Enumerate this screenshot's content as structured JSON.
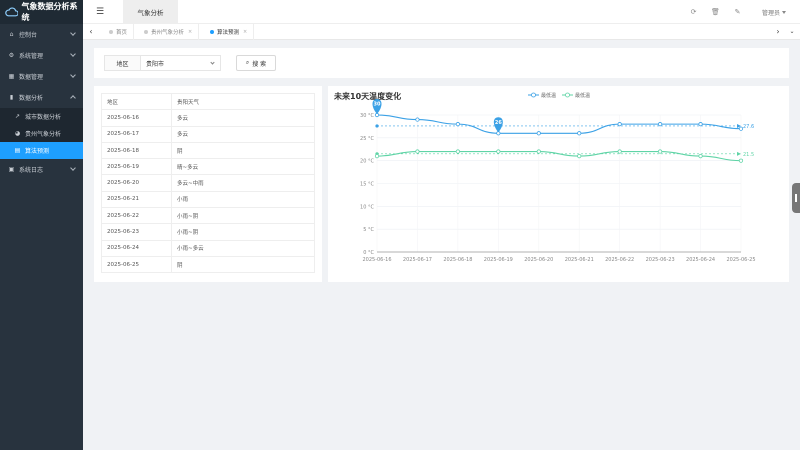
{
  "app": {
    "title": "气象数据分析系统"
  },
  "sidebar": {
    "items": [
      {
        "label": "控制台",
        "icon": "home-icon"
      },
      {
        "label": "系统管理",
        "icon": "gears-icon"
      },
      {
        "label": "数据管理",
        "icon": "grid-icon"
      },
      {
        "label": "数据分析",
        "icon": "chart-icon",
        "expanded": true,
        "children": [
          {
            "label": "城市数据分析",
            "icon": "line-chart-icon"
          },
          {
            "label": "贵州气象分析",
            "icon": "pie-chart-icon"
          },
          {
            "label": "算法预测",
            "icon": "document-icon",
            "active": true
          }
        ]
      },
      {
        "label": "系统日志",
        "icon": "log-icon"
      }
    ]
  },
  "header": {
    "tab": "气象分析",
    "user": "管理员"
  },
  "tabs": [
    {
      "label": "首页",
      "closable": false
    },
    {
      "label": "贵州气象分析",
      "closable": true
    },
    {
      "label": "算法预测",
      "closable": true,
      "active": true
    }
  ],
  "search": {
    "label": "地区",
    "value": "贵阳市",
    "button": "搜 索"
  },
  "table": {
    "headers": [
      "地区",
      "贵阳天气"
    ],
    "rows": [
      [
        "2025-06-16",
        "多云"
      ],
      [
        "2025-06-17",
        "多云"
      ],
      [
        "2025-06-18",
        "阴"
      ],
      [
        "2025-06-19",
        "晴~多云"
      ],
      [
        "2025-06-20",
        "多云~中雨"
      ],
      [
        "2025-06-21",
        "小雨"
      ],
      [
        "2025-06-22",
        "小雨~阴"
      ],
      [
        "2025-06-23",
        "小雨~阴"
      ],
      [
        "2025-06-24",
        "小雨~多云"
      ],
      [
        "2025-06-25",
        "阴"
      ]
    ]
  },
  "chart_data": {
    "type": "line",
    "title": "未来10天温度变化",
    "x": [
      "2025-06-16",
      "2025-06-17",
      "2025-06-18",
      "2025-06-19",
      "2025-06-20",
      "2025-06-21",
      "2025-06-22",
      "2025-06-23",
      "2025-06-24",
      "2025-06-25"
    ],
    "series": [
      {
        "name": "最低温",
        "color": "#3ba1e6",
        "values": [
          30,
          29,
          28,
          26,
          26,
          26,
          28,
          28,
          28,
          27
        ],
        "max_label": "30",
        "min_label": "26",
        "avg_label": "27.6"
      },
      {
        "name": "最低温",
        "color": "#5fd4a6",
        "values": [
          21,
          22,
          22,
          22,
          22,
          21,
          22,
          22,
          21,
          20
        ],
        "avg_label": "21.5"
      }
    ],
    "ylim": [
      0,
      30
    ],
    "yticks": [
      "0 °C",
      "5 °C",
      "10 °C",
      "15 °C",
      "20 °C",
      "25 °C",
      "30 °C"
    ],
    "legend": "top-center",
    "grid": true
  }
}
